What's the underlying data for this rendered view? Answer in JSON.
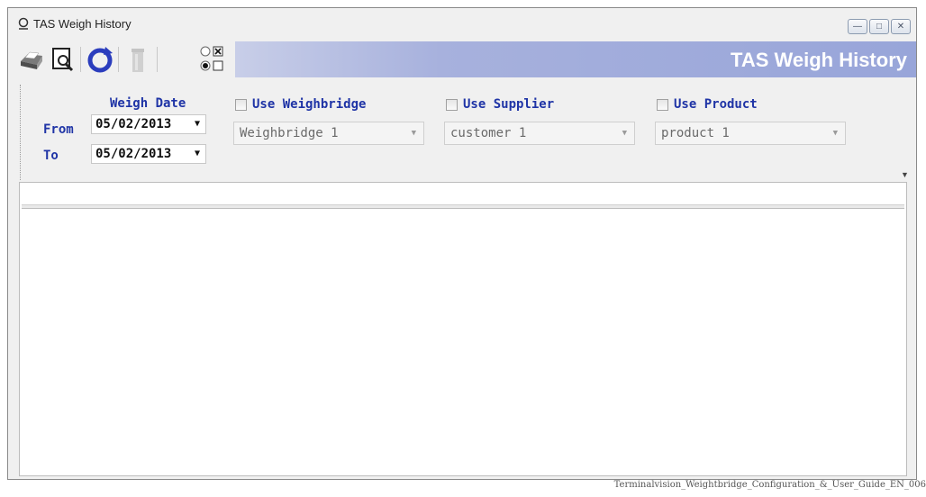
{
  "window": {
    "title": "TAS Weigh History",
    "controls": [
      "minimize",
      "maximize",
      "close"
    ]
  },
  "toolbar": {
    "banner_title": "TAS Weigh History",
    "icons": [
      "printer-icon",
      "print-preview-icon",
      "refresh-icon",
      "delete-icon",
      "radio-checkbox-toggle-icon"
    ]
  },
  "filters": {
    "weigh_date_label": "Weigh Date",
    "from_label": "From",
    "from_value": "05/02/2013",
    "to_label": "To",
    "to_value": "05/02/2013",
    "use_weighbridge_label": "Use Weighbridge",
    "weighbridge_value": "Weighbridge 1",
    "use_supplier_label": "Use Supplier",
    "supplier_value": "customer 1",
    "use_product_label": "Use Product",
    "product_value": "product 1"
  },
  "caption": "Terminalvision_Weightbridge_Configuration_&_User_Guide_EN_006",
  "colors": {
    "label_blue": "#1f34a6",
    "banner_blue": "#98a5d9",
    "refresh_blue": "#2b3dbd"
  }
}
